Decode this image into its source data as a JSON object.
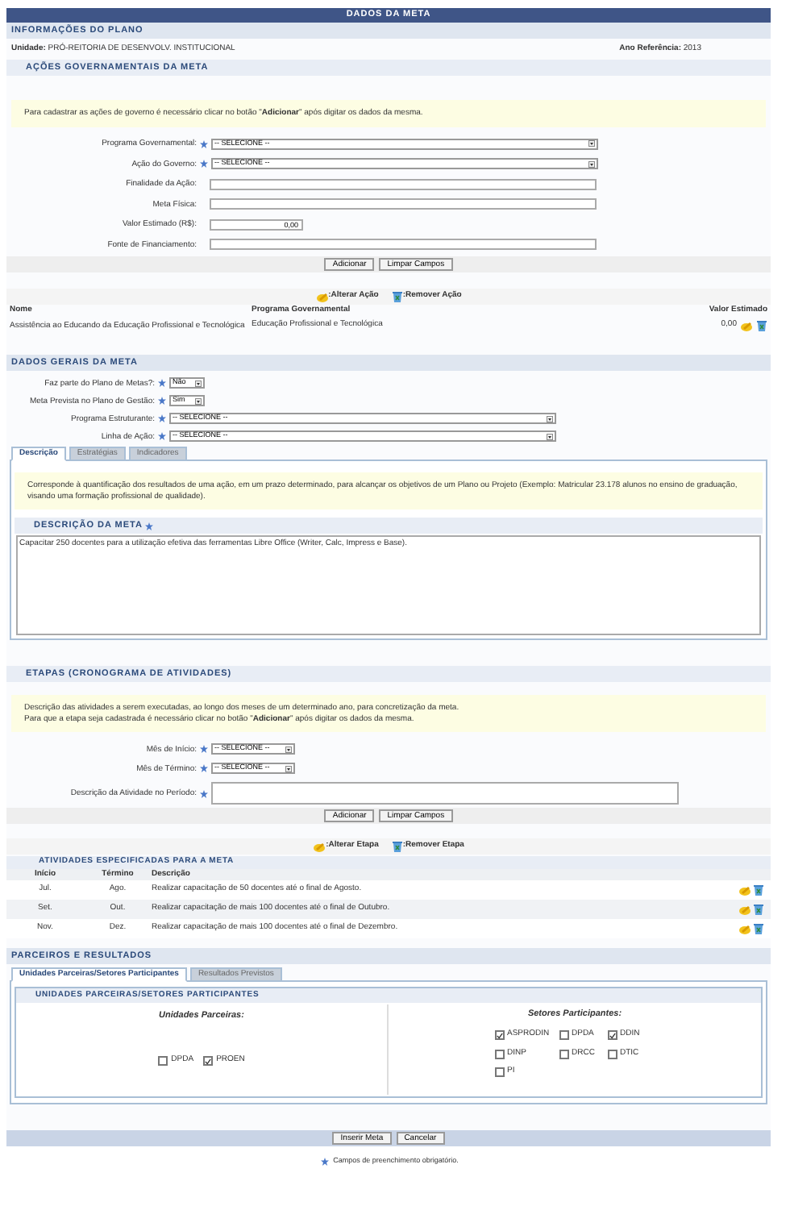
{
  "title": "DADOS DA META",
  "plan_info": {
    "heading": "INFORMAÇÕES DO PLANO",
    "unit_label": "Unidade:",
    "unit_value": "PRÓ-REITORIA DE DESENVOLV. INSTITUCIONAL",
    "year_label": "Ano Referência:",
    "year_value": "2013"
  },
  "government_actions": {
    "heading": "AÇÕES GOVERNAMENTAIS DA META",
    "note": "Para cadastrar as ações de governo é necessário clicar no botão \"**Adicionar**\" após digitar os dados da mesma.",
    "fields": [
      {
        "label": "Programa Governamental:",
        "kind": "select",
        "required": true,
        "value": "-- SELECIONE --"
      },
      {
        "label": "Ação do Governo:",
        "kind": "select",
        "required": true,
        "value": "-- SELECIONE --"
      },
      {
        "label": "Finalidade da Ação:",
        "kind": "text",
        "required": false
      },
      {
        "label": "Meta Física:",
        "kind": "text",
        "required": false
      },
      {
        "label": "Valor Estimado (R$):",
        "kind": "number",
        "required": false,
        "value": "0,00"
      },
      {
        "label": "Fonte de Financiamento:",
        "kind": "text",
        "required": false
      }
    ],
    "buttons": [
      "Adicionar",
      "Limpar Campos"
    ],
    "legend": [
      {
        "kind": "edit",
        "label": ":Alterar Ação"
      },
      {
        "kind": "delete",
        "label": ":Remover Ação"
      }
    ],
    "table": {
      "columns": [
        "Nome",
        "Programa Governamental",
        "Valor Estimado"
      ],
      "rows": [
        {
          "name": "Assistência ao Educando da Educação Profissional e Tecnológica",
          "program": "Educação Profissional e Tecnológica",
          "value": "0,00"
        }
      ]
    }
  },
  "general": {
    "heading": "DADOS GERAIS DA META",
    "fields": [
      {
        "label": "Faz parte do Plano de Metas?:",
        "kind": "short-select",
        "required": true,
        "value": "Não"
      },
      {
        "label": "Meta Prevista no Plano de Gestão:",
        "kind": "short-select",
        "required": true,
        "value": "Sim"
      },
      {
        "label": "Programa Estruturante:",
        "kind": "select",
        "required": true,
        "value": "-- SELECIONE --"
      },
      {
        "label": "Linha de Ação:",
        "kind": "select",
        "required": true,
        "value": "-- SELECIONE --"
      }
    ],
    "tabs": [
      {
        "label": "Descrição",
        "selected": true
      },
      {
        "label": "Estratégias",
        "selected": false
      },
      {
        "label": "Indicadores",
        "selected": false
      }
    ],
    "note": "Corresponde à quantificação dos resultados de uma ação, em um prazo determinado, para alcançar os objetivos de um Plano ou Projeto (Exemplo: Matricular 23.178 alunos no ensino de graduação, visando uma formação profissional de qualidade).",
    "description_heading": "DESCRIÇÃO DA META",
    "description_required": true,
    "description_value": "Capacitar 250 docentes para a utilização efetiva das ferramentas Libre Office (Writer, Calc, Impress e Base)."
  },
  "stages": {
    "heading": "ETAPAS (CRONOGRAMA DE ATIVIDADES)",
    "note": "Descrição das atividades a serem executadas, ao longo dos meses de um determinado ano, para concretização da meta.\nPara que a etapa seja cadastrada é necessário clicar no botão \"**Adicionar**\" após digitar os dados da mesma.",
    "fields": [
      {
        "label": "Mês de Início:",
        "kind": "month-select",
        "required": true,
        "value": "-- SELECIONE --"
      },
      {
        "label": "Mês de Término:",
        "kind": "month-select",
        "required": true,
        "value": "-- SELECIONE --"
      },
      {
        "label": "Descrição da Atividade no Período:",
        "kind": "textarea",
        "required": true
      }
    ],
    "buttons": [
      "Adicionar",
      "Limpar Campos"
    ],
    "legend": [
      {
        "kind": "edit",
        "label": ":Alterar Etapa"
      },
      {
        "kind": "delete",
        "label": ":Remover Etapa"
      }
    ],
    "table": {
      "heading": "ATIVIDADES ESPECIFICADAS PARA A META",
      "columns": [
        "Início",
        "Término",
        "Descrição"
      ],
      "rows": [
        {
          "start": "Jul.",
          "end": "Ago.",
          "description": "Realizar capacitação de 50 docentes até o final de Agosto."
        },
        {
          "start": "Set.",
          "end": "Out.",
          "description": "Realizar capacitação de mais 100 docentes até o final de Outubro."
        },
        {
          "start": "Nov.",
          "end": "Dez.",
          "description": "Realizar capacitação de mais 100 docentes até o final de Dezembro."
        }
      ]
    }
  },
  "partners": {
    "heading": "PARCEIROS E RESULTADOS",
    "tabs": [
      {
        "label": "Unidades Parceiras/Setores Participantes",
        "selected": true
      },
      {
        "label": "Resultados Previstos",
        "selected": false
      }
    ],
    "panel_heading": "UNIDADES PARCEIRAS/SETORES PARTICIPANTES",
    "units_title": "Unidades Parceiras:",
    "units": [
      {
        "label": "DPDA",
        "checked": false
      },
      {
        "label": "PROEN",
        "checked": true
      }
    ],
    "sectors_title": "Setores Participantes:",
    "sectors": [
      {
        "label": "ASPRODIN",
        "checked": true
      },
      {
        "label": "DPDA",
        "checked": false
      },
      {
        "label": "DDIN",
        "checked": true
      },
      {
        "label": "DINP",
        "checked": false
      },
      {
        "label": "DRCC",
        "checked": false
      },
      {
        "label": "DTIC",
        "checked": false
      },
      {
        "label": "PI",
        "checked": false
      }
    ]
  },
  "actions": [
    "Inserir Meta",
    "Cancelar"
  ],
  "footnote": "Campos de preenchimento obrigatório."
}
